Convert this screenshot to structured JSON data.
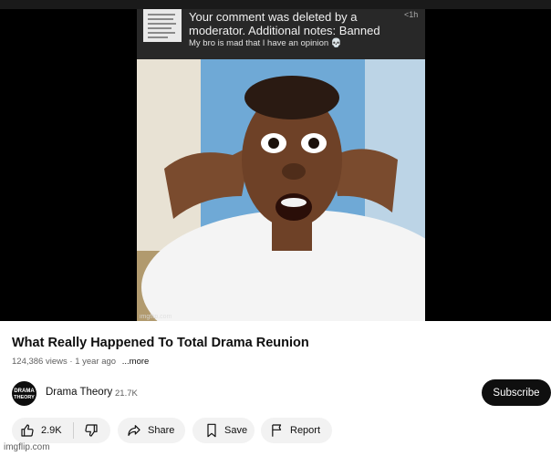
{
  "notification": {
    "headline": "Your comment was deleted by a moderator. Additional notes: Banned",
    "subtext": "My bro is mad that I have an opinion 💀",
    "time": "<1h"
  },
  "video": {
    "watermark": "imgflip.com",
    "title": "What Really Happened To Total Drama Reunion",
    "views": "124,386 views",
    "age": "1 year ago",
    "more_label": "...more"
  },
  "channel": {
    "avatar_text": "DRAMA THEORY",
    "name": "Drama Theory",
    "subscribers": "21.7K",
    "subscribe_label": "Subscribe"
  },
  "actions": {
    "like_count": "2.9K",
    "share_label": "Share",
    "save_label": "Save",
    "report_label": "Report"
  },
  "footer": {
    "watermark": "imgflip.com"
  },
  "icons": [
    "like-icon",
    "dislike-icon",
    "share-icon",
    "save-icon",
    "flag-icon",
    "skull-icon"
  ],
  "colors": {
    "subscribe_bg": "#0f0f0f",
    "pill_bg": "#f2f2f2",
    "notification_bg": "#282828"
  }
}
